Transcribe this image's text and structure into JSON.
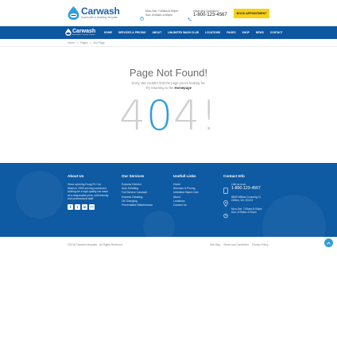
{
  "brand": {
    "name": "Carwash",
    "tagline": "Automobile & Detailing Template",
    "nav_tagline": "Automobile & Detailing Template"
  },
  "header": {
    "hours_line1": "Mon-Sat: 7:00am-6:00pm",
    "hours_line2": "Sun: 8:00am-4:00pm",
    "phone_label": "Have any Question?",
    "phone_number": "1-800-123-4567",
    "appointment_button": "BOOK APPOINTMENT"
  },
  "nav": {
    "items": [
      "HOME",
      "SERVICES & PRICING",
      "ABOUT",
      "UNLIMITED WASH CLUB",
      "LOCATIONS",
      "PAGES",
      "SHOP",
      "NEWS",
      "CONTACT"
    ]
  },
  "breadcrumb": {
    "items": [
      "Home",
      "»",
      "Pages",
      "»",
      "404 Page"
    ]
  },
  "main": {
    "title": "Page Not Found!",
    "text_line1": "Sorry, We couldn't find the page you're looking for.",
    "text_line2_prefix": "Try returning to the",
    "text_line2_link": "Homepage",
    "code_left": "4",
    "code_mid": "0",
    "code_right": "4!"
  },
  "footer": {
    "about": {
      "heading": "About Us",
      "lines": [
        "Since opening Doug Fir Car",
        "Wash in 1990 serving customers",
        "looking for a high quality car wash",
        "at a reasonable price, with friendly",
        "and professional staff."
      ],
      "social": [
        "f",
        "t",
        "in",
        "rss"
      ]
    },
    "services": {
      "heading": "Our Services",
      "items": [
        "Express Exterior",
        "Auto Detailing",
        "Full Service Carwash",
        "Express Detailing",
        "Oil Changing",
        "Preventative Maintenance"
      ]
    },
    "links": {
      "heading": "Usefull Links",
      "items": [
        "Home",
        "Services & Pricing",
        "Unlimited Wash Club",
        "About",
        "Locations",
        "Contact Us"
      ]
    },
    "contact": {
      "heading": "Contact Info",
      "call_label": "Call us now:",
      "call_number": "1-800-123-4567",
      "address_line1": "8809 Willow Crossing Ct",
      "address_line2": "Clifton, VA, 20124",
      "hours_line1": "Mon-Sat: 7:00am-6:00pm",
      "hours_line2": "Sun: 8:00am-4:00pm"
    }
  },
  "bottom": {
    "copyright": "©2018 Carwash template - All Rights Reserved",
    "links": [
      "Site Map",
      "Terms and Conditions",
      "Privacy Policy"
    ]
  },
  "colors": {
    "primary": "#0d57a0",
    "accent": "#2f9edb",
    "button": "#f7d117"
  },
  "icons": [
    "drop-logo-icon",
    "clock-icon",
    "phone-icon",
    "mobile-icon",
    "map-pin-icon",
    "chevron-up-icon"
  ]
}
